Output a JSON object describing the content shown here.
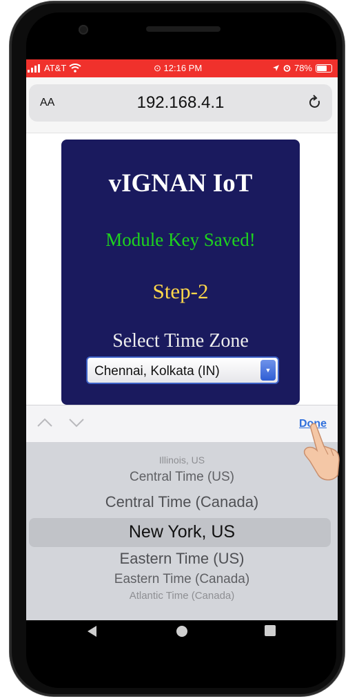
{
  "status_bar": {
    "carrier": "AT&T",
    "time": "12:16 PM",
    "battery": "78%",
    "battery_level": 0.78,
    "color": "#f0312c"
  },
  "browser": {
    "text_size_label": "AA",
    "url": "192.168.4.1",
    "reload_icon": "reload-icon"
  },
  "page": {
    "title": "vIGNAN IoT",
    "status_message": "Module Key Saved!",
    "step": "Step-2",
    "timezone_label": "Select Time Zone",
    "timezone_selected": "Chennai, Kolkata (IN)",
    "card_color": "#1a1a5e"
  },
  "keyboard_accessory": {
    "prev_icon": "chevron-up-icon",
    "next_icon": "chevron-down-icon",
    "done_label": "Done"
  },
  "picker": {
    "options": [
      "Illinois, US",
      "Central Time (US)",
      "Central Time (Canada)",
      "New York, US",
      "Eastern Time (US)",
      "Eastern Time (Canada)",
      "Atlantic Time (Canada)"
    ],
    "selected_index": 3
  }
}
